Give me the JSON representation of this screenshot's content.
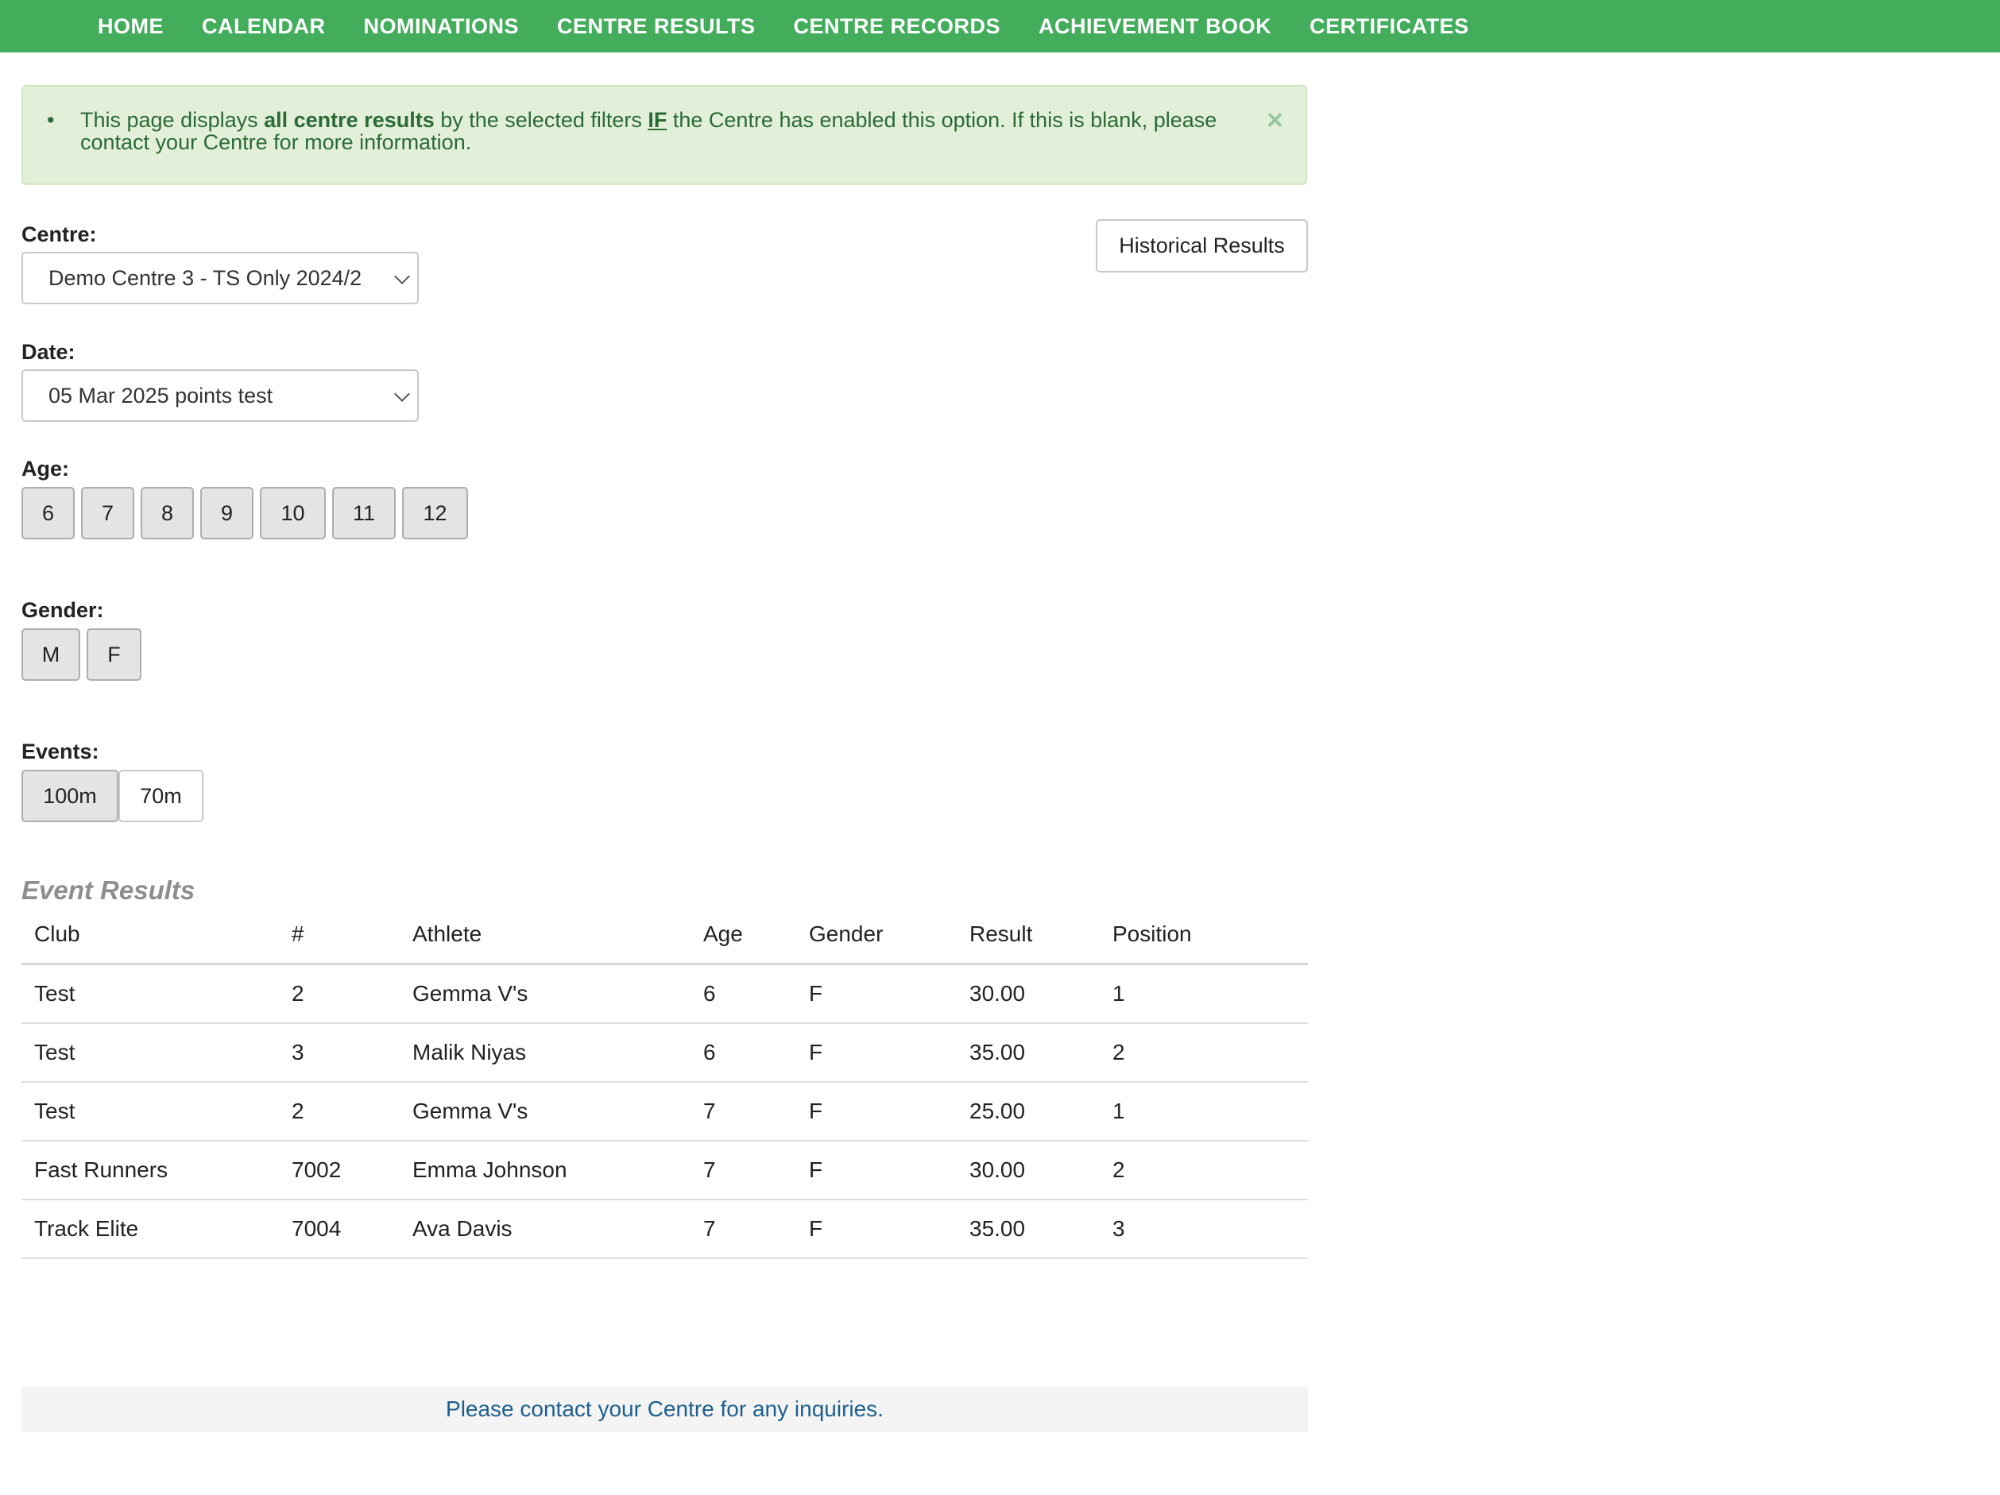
{
  "nav": {
    "items": [
      "HOME",
      "CALENDAR",
      "NOMINATIONS",
      "CENTRE RESULTS",
      "CENTRE RECORDS",
      "ACHIEVEMENT BOOK",
      "CERTIFICATES"
    ]
  },
  "alert": {
    "text_1": "This page displays ",
    "bold_1": "all centre results",
    "text_2": " by the selected filters ",
    "underline": "IF",
    "text_3": " the Centre has enabled this option. If this is blank, please contact your Centre for more information.",
    "close_symbol": "×"
  },
  "filters": {
    "centre_label": "Centre:",
    "centre_value": "Demo Centre 3 - TS Only 2024/2",
    "date_label": "Date:",
    "date_value": "05 Mar 2025 points test",
    "age_label": "Age:",
    "ages": [
      "6",
      "7",
      "8",
      "9",
      "10",
      "11",
      "12"
    ],
    "gender_label": "Gender:",
    "genders": [
      "M",
      "F"
    ],
    "events_label": "Events:",
    "events": [
      "100m",
      "70m"
    ],
    "historical_button": "Historical Results"
  },
  "results": {
    "title": "Event Results",
    "headers": [
      "Club",
      "#",
      "Athlete",
      "Age",
      "Gender",
      "Result",
      "Position"
    ],
    "rows": [
      [
        "Test",
        "2",
        "Gemma V's",
        "6",
        "F",
        "30.00",
        "1"
      ],
      [
        "Test",
        "3",
        "Malik Niyas",
        "6",
        "F",
        "35.00",
        "2"
      ],
      [
        "Test",
        "2",
        "Gemma V's",
        "7",
        "F",
        "25.00",
        "1"
      ],
      [
        "Fast Runners",
        "7002",
        "Emma Johnson",
        "7",
        "F",
        "30.00",
        "2"
      ],
      [
        "Track Elite",
        "7004",
        "Ava Davis",
        "7",
        "F",
        "35.00",
        "3"
      ]
    ]
  },
  "footer": {
    "text": "Please contact your Centre for any inquiries."
  },
  "colors": {
    "nav_bg": "#43ad5c",
    "alert_bg": "#e2f0da",
    "alert_text": "#2b6a35",
    "footer_text": "#1d5f8e"
  }
}
